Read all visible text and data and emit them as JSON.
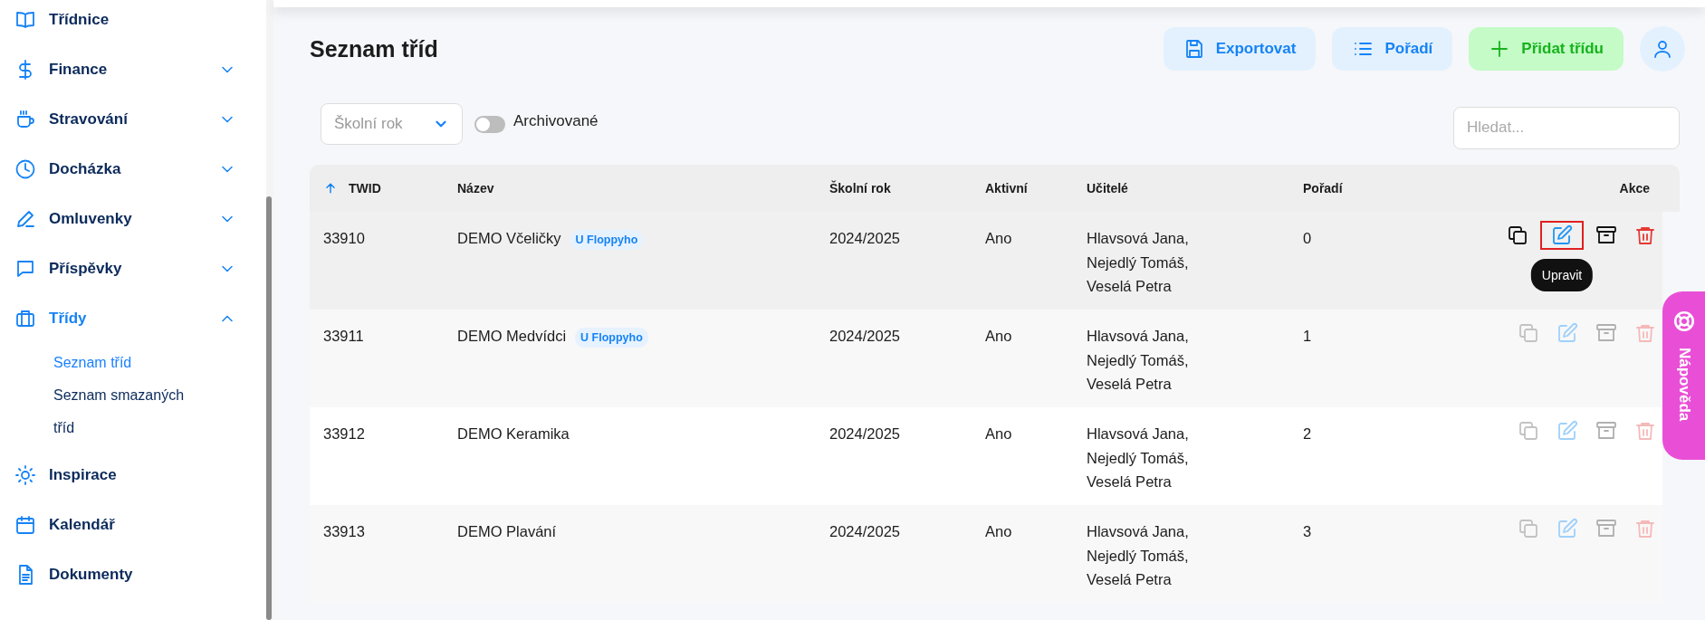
{
  "sidebar": {
    "items": [
      {
        "label": "Třídnice",
        "selected": false
      },
      {
        "label": "Finance",
        "selected": false,
        "expanded": false
      },
      {
        "label": "Stravování",
        "selected": false,
        "expanded": false
      },
      {
        "label": "Docházka",
        "selected": false,
        "expanded": false
      },
      {
        "label": "Omluvenky",
        "selected": false,
        "expanded": false
      },
      {
        "label": "Příspěvky",
        "selected": false,
        "expanded": false
      },
      {
        "label": "Třídy",
        "selected": true,
        "expanded": true,
        "children": [
          {
            "label": "Seznam tříd",
            "selected": true
          },
          {
            "label": "Seznam smazaných tříd",
            "selected": false
          }
        ]
      },
      {
        "label": "Inspirace",
        "selected": false
      },
      {
        "label": "Kalendář",
        "selected": false
      },
      {
        "label": "Dokumenty",
        "selected": false
      }
    ]
  },
  "page": {
    "title": "Seznam tříd"
  },
  "toolbar": [
    {
      "kind": "export",
      "label": "Exportovat"
    },
    {
      "kind": "order",
      "label": "Pořadí"
    },
    {
      "kind": "add",
      "label": "Přidat třídu"
    }
  ],
  "filters": {
    "school_year": {
      "placeholder": "Školní rok"
    },
    "archived": {
      "label": "Archivované",
      "on": false
    },
    "search": {
      "placeholder": "Hledat..."
    }
  },
  "table": {
    "columns": [
      {
        "label": "TWID",
        "sorted": true
      },
      {
        "label": "Název"
      },
      {
        "label": "Školní rok"
      },
      {
        "label": "Aktivní"
      },
      {
        "label": "Učitelé"
      },
      {
        "label": "Pořadí"
      },
      {
        "label": "Akce"
      }
    ],
    "rows": [
      {
        "twid": "33910",
        "name": "DEMO Včeličky",
        "tag": "U Floppyho",
        "year": "2024/2025",
        "active": "Ano",
        "teachers": "Hlavsová Jana, Nejedlý Tomáš, Veselá Petra",
        "order": "0",
        "hovered": true,
        "edit_focused": true,
        "tooltip": "Upravit"
      },
      {
        "twid": "33911",
        "name": "DEMO Medvídci",
        "tag": "U Floppyho",
        "year": "2024/2025",
        "active": "Ano",
        "teachers": "Hlavsová Jana, Nejedlý Tomáš, Veselá Petra",
        "order": "1",
        "hovered": false,
        "edit_focused": false
      },
      {
        "twid": "33912",
        "name": "DEMO Keramika",
        "year": "2024/2025",
        "active": "Ano",
        "teachers": "Hlavsová Jana, Nejedlý Tomáš, Veselá Petra",
        "order": "2",
        "hovered": false,
        "edit_focused": false
      },
      {
        "twid": "33913",
        "name": "DEMO Plavání",
        "year": "2024/2025",
        "active": "Ano",
        "teachers": "Hlavsová Jana, Nejedlý Tomáš, Veselá Petra",
        "order": "3",
        "hovered": false,
        "edit_focused": false
      }
    ]
  },
  "help_tab": {
    "label": "Nápověda"
  }
}
